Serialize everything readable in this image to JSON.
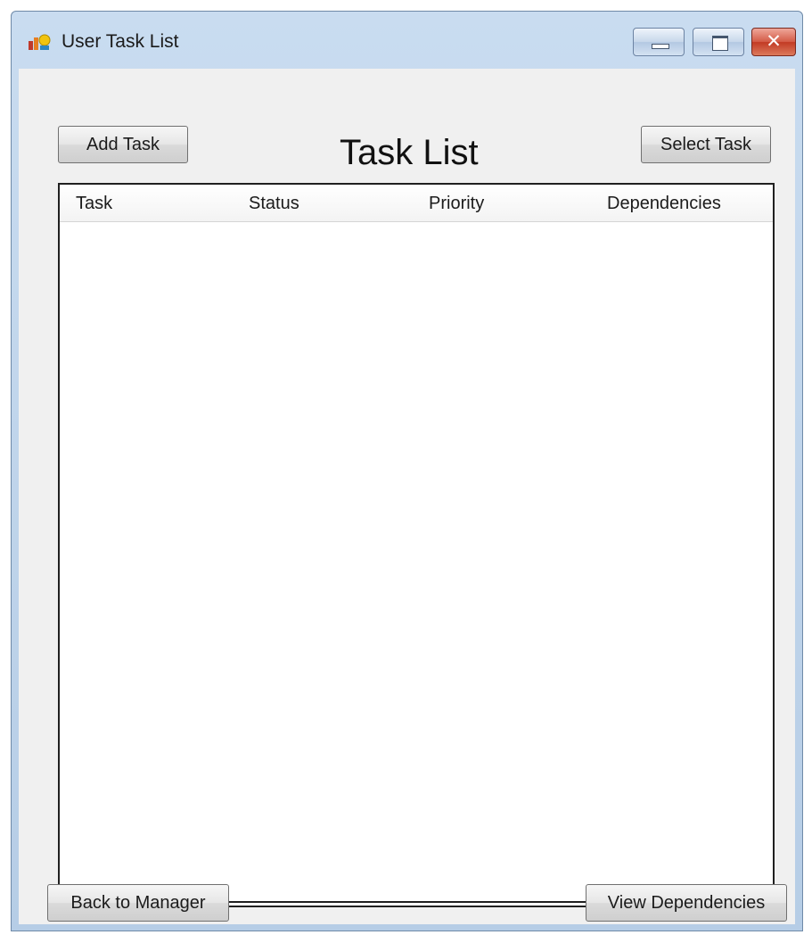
{
  "window": {
    "title": "User Task List",
    "close_glyph": "✕"
  },
  "toolbar": {
    "add_task_label": "Add Task",
    "select_task_label": "Select Task"
  },
  "page_title": "Task List",
  "task_list": {
    "columns": [
      "Task",
      "Status",
      "Priority",
      "Dependencies"
    ],
    "rows": []
  },
  "footer": {
    "back_label": "Back to Manager",
    "view_dependencies_label": "View Dependencies"
  }
}
